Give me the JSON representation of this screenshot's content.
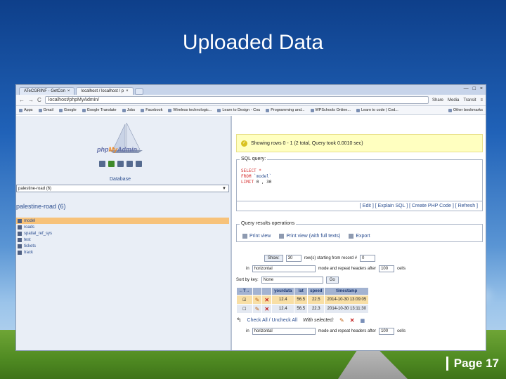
{
  "slide": {
    "title": "Uploaded Data",
    "page_label": "Page 17"
  },
  "browser": {
    "tabs": [
      "ATeCGRINF - GetCon",
      "localhost / localhost / p"
    ],
    "address": "localhost/phpMyAdmin/",
    "toolbar_icons": [
      "Share",
      "Media",
      "Transit"
    ],
    "bookmarks": [
      "Apps",
      "Gmail",
      "Google",
      "Google Translate",
      "Jobs",
      "Facebook",
      "Wireless technologic...",
      "Learn to Design - Cou",
      "Programming and...",
      "WPSchools Online...",
      "Learn to code | Cod...",
      "Other bookmarks"
    ]
  },
  "left_pane": {
    "logo_php": "php",
    "logo_my": "My",
    "logo_admin": "Admin",
    "database_label": "Database",
    "database_select": "palestine-road (6)",
    "db_heading": "palestine-road (6)",
    "tables": [
      "model",
      "roads",
      "spatial_ref_sys",
      "test",
      "tickets",
      "track"
    ],
    "selected_table": "model"
  },
  "right_pane": {
    "success_message": "Showing rows 0 - 1 (2 total, Query took 0.0010 sec)",
    "sql_legend": "SQL query:",
    "sql_line1_kw": "SELECT *",
    "sql_line2_kw": "FROM",
    "sql_line2_tb": "`model`",
    "sql_line3_kw": "LIMIT",
    "sql_line3_val": "0 , 30",
    "sql_links": "[ Edit ] [ Explain SQL ] [ Create PHP Code ] [ Refresh ]",
    "ops_legend": "Query results operations",
    "op_print": "Print view",
    "op_print_full": "Print view (with full texts)",
    "op_export": "Export",
    "show_button": "Show:",
    "rows_value": "30",
    "rows_label": "row(s) starting from record #",
    "start_value": "0",
    "in_label": "in",
    "mode_value": "horizontal",
    "mode_label": "mode and repeat headers after",
    "repeat_value": "100",
    "cells_label": "cells",
    "sort_label": "Sort by key:",
    "sort_value": "None",
    "go_button": "Go",
    "columns": [
      "yourdata",
      "lat",
      "speed",
      "timestamp"
    ],
    "rows": [
      [
        "12.4",
        "56.5",
        "22.5",
        "2014-10-30 13:09:05"
      ],
      [
        "12.4",
        "56.5",
        "22.3",
        "2014-10-30 13:11:30"
      ]
    ],
    "check_all": "Check All / Uncheck All",
    "with_selected": "With selected:"
  },
  "colors": {
    "slide_bg_top": "#0e3f8a",
    "selected_row": "#f8dfa6",
    "success_bg": "#ffffc0",
    "link": "#2a4d8f"
  }
}
